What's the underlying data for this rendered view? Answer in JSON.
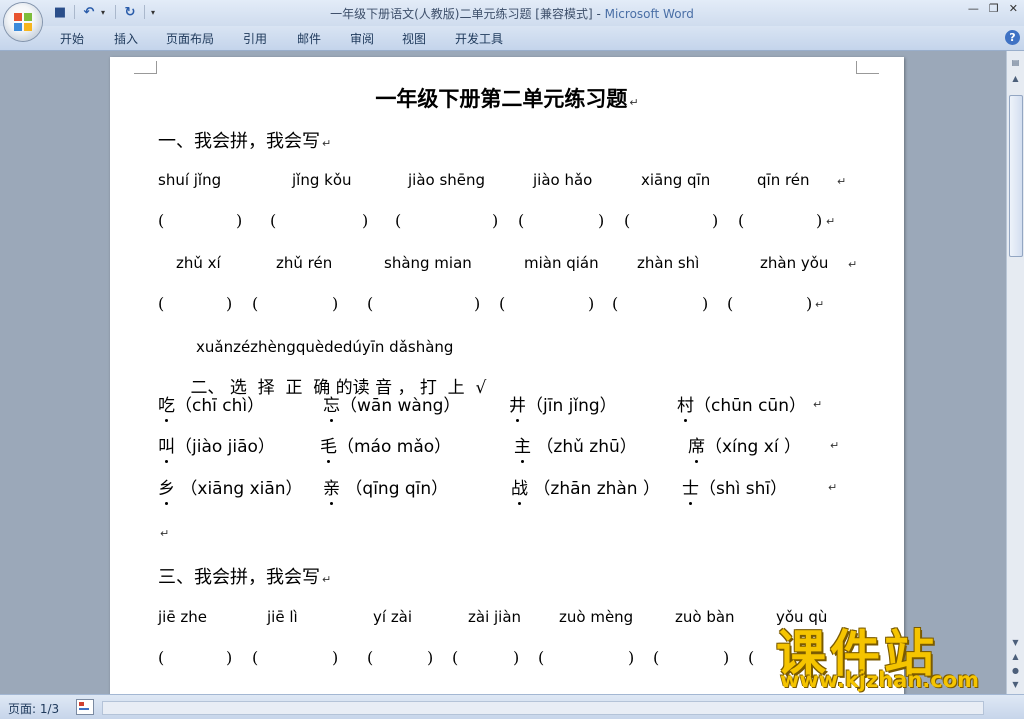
{
  "window": {
    "title": "一年级下册语文(人教版)二单元练习题 [兼容模式] - ",
    "app": "Microsoft Word"
  },
  "ribbon": {
    "tabs": [
      "开始",
      "插入",
      "页面布局",
      "引用",
      "邮件",
      "审阅",
      "视图",
      "开发工具"
    ]
  },
  "document": {
    "title": "一年级下册第二单元练习题",
    "section1": {
      "heading": "一、我会拼，我会写",
      "row1": [
        "shuí  jǐng",
        "jǐng kǒu",
        "jiào shēng",
        "jiào hǎo",
        "xiāng qīn",
        "qīn rén"
      ],
      "row2": [
        "zhǔ xí",
        "zhǔ rén",
        "shàng mian",
        "miàn qián",
        "zhàn shì",
        "zhàn yǒu"
      ],
      "paren_open": "(",
      "paren_close": ")"
    },
    "section2": {
      "pinyin": "xuǎnzézhèngquèdedúyīn  dǎshàng",
      "heading": "二、 选  择  正  确 的读 音 ， 打  上  √",
      "items": [
        {
          "char": "吃",
          "options": "（chī  chì）"
        },
        {
          "char": "忘",
          "options": "（wān  wàng）"
        },
        {
          "char": "井",
          "options": "（jīn  jǐng）"
        },
        {
          "char": "村",
          "options": "（chūn cūn）"
        },
        {
          "char": "叫",
          "options": "（jiào jiāo）"
        },
        {
          "char": "毛",
          "options": "（máo mǎo）"
        },
        {
          "char": "主",
          "options": " （zhǔ zhū）"
        },
        {
          "char": "席",
          "options": "（xíng  xí ）"
        },
        {
          "char": "乡",
          "options": " （xiāng xiān）"
        },
        {
          "char": "亲",
          "options": " （qīng  qīn）"
        },
        {
          "char": "战",
          "options": " （zhān zhàn ）"
        },
        {
          "char": "士",
          "options": "（shì  shī）"
        }
      ]
    },
    "section3": {
      "heading": "三、我会拼，我会写",
      "row1": [
        "jiē zhe",
        "jiē lì",
        "yí zài",
        "zài jiàn",
        "zuò mèng",
        "zuò bàn",
        "yǒu qù"
      ]
    },
    "paragraph_mark": "↵"
  },
  "status": {
    "page": "页面: 1/3"
  },
  "watermark": {
    "main": "课件站",
    "url": "www.kjzhan.com"
  }
}
